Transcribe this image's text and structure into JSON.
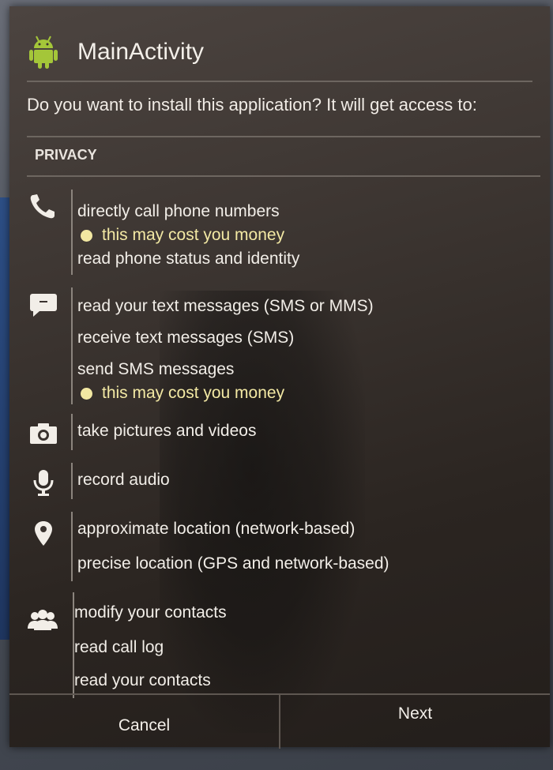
{
  "dialog": {
    "title": "MainActivity",
    "question": "Do you want to install this application? It will get access to:",
    "section_label": "PRIVACY"
  },
  "groups": [
    {
      "icon": "phone-icon",
      "items": [
        {
          "text": "directly call phone numbers"
        },
        {
          "warning": "this may cost you money"
        },
        {
          "text": "read phone status and identity"
        }
      ]
    },
    {
      "icon": "message-icon",
      "items": [
        {
          "text": "read your text messages (SMS or MMS)"
        },
        {
          "text": "receive text messages (SMS)"
        },
        {
          "text": "send SMS messages"
        },
        {
          "warning": "this may cost you money"
        }
      ]
    },
    {
      "icon": "camera-icon",
      "items": [
        {
          "text": "take pictures and videos"
        }
      ]
    },
    {
      "icon": "microphone-icon",
      "items": [
        {
          "text": "record audio"
        }
      ]
    },
    {
      "icon": "location-pin-icon",
      "items": [
        {
          "text": "approximate location (network-based)"
        },
        {
          "text": "precise location (GPS and network-based)"
        }
      ]
    },
    {
      "icon": "contacts-icon",
      "items": [
        {
          "text": "modify your contacts"
        },
        {
          "text": "read call log"
        },
        {
          "text": "read your contacts"
        }
      ]
    }
  ],
  "buttons": {
    "cancel": "Cancel",
    "next": "Next"
  },
  "colors": {
    "warning": "#f3e9a4",
    "text": "#f2eee8",
    "android_green": "#a4c639"
  }
}
